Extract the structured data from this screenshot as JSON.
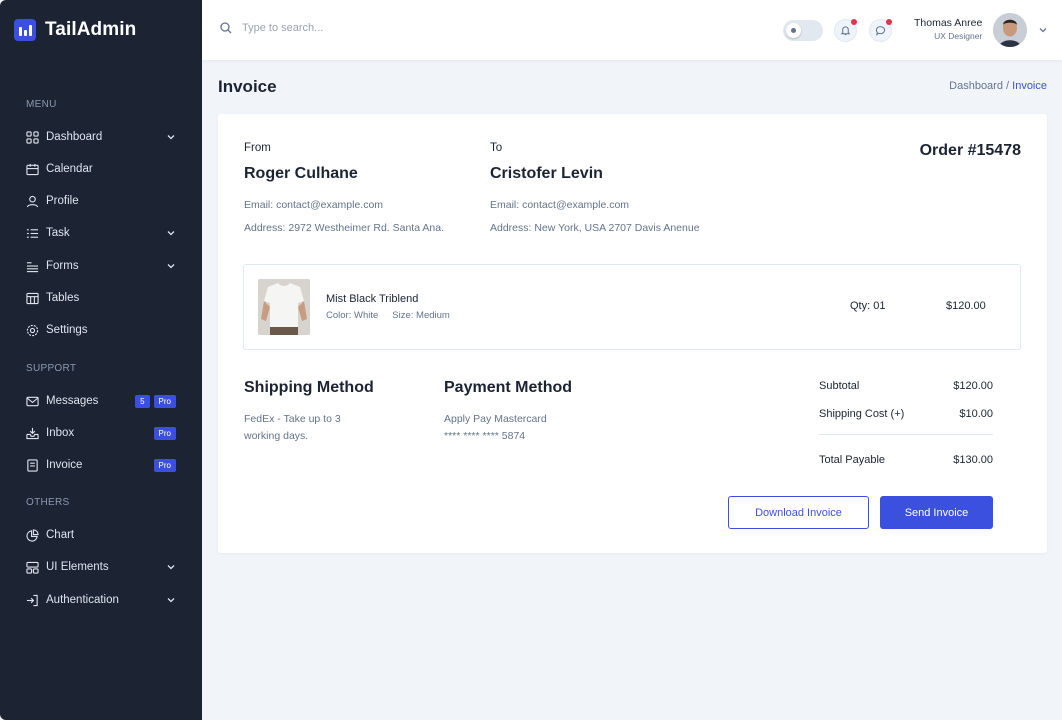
{
  "brand": {
    "name": "TailAdmin",
    "accent": "#3C50E0",
    "sidebar_bg": "#1C2434"
  },
  "sidebar": {
    "groups": [
      {
        "title": "MENU",
        "items": [
          {
            "label": "Dashboard",
            "icon": "grid-icon",
            "chevron": true
          },
          {
            "label": "Calendar",
            "icon": "calendar-icon",
            "chevron": false
          },
          {
            "label": "Profile",
            "icon": "user-icon",
            "chevron": false
          },
          {
            "label": "Task",
            "icon": "list-icon",
            "chevron": true
          },
          {
            "label": "Forms",
            "icon": "form-icon",
            "chevron": true
          },
          {
            "label": "Tables",
            "icon": "table-icon",
            "chevron": false
          },
          {
            "label": "Settings",
            "icon": "gear-icon",
            "chevron": false
          }
        ]
      },
      {
        "title": "SUPPORT",
        "items": [
          {
            "label": "Messages",
            "icon": "mail-icon",
            "count": "5",
            "pro": "Pro"
          },
          {
            "label": "Inbox",
            "icon": "inbox-icon",
            "pro": "Pro"
          },
          {
            "label": "Invoice",
            "icon": "document-icon",
            "pro": "Pro"
          }
        ]
      },
      {
        "title": "OTHERS",
        "items": [
          {
            "label": "Chart",
            "icon": "pie-chart-icon",
            "chevron": false
          },
          {
            "label": "UI Elements",
            "icon": "layout-icon",
            "chevron": true
          },
          {
            "label": "Authentication",
            "icon": "login-icon",
            "chevron": true
          }
        ]
      }
    ]
  },
  "header": {
    "search_placeholder": "Type to search...",
    "user_name": "Thomas Anree",
    "user_role": "UX Designer"
  },
  "page": {
    "title": "Invoice",
    "breadcrumb": {
      "root": "Dashboard /",
      "current": "Invoice"
    }
  },
  "invoice": {
    "from_label": "From",
    "from_name": "Roger Culhane",
    "from_email": "Email: contact@example.com",
    "from_address": "Address: 2972 Westheimer Rd. Santa Ana.",
    "to_label": "To",
    "to_name": "Cristofer Levin",
    "to_email": "Email: contact@example.com",
    "to_address": "Address: New York, USA 2707 Davis Anenue",
    "order": "Order #15478",
    "item": {
      "name": "Mist Black Triblend",
      "color": "Color: White",
      "size": "Size: Medium",
      "qty": "Qty: 01",
      "price": "$120.00"
    },
    "shipping_title": "Shipping Method",
    "shipping_line1": "FedEx - Take up to 3",
    "shipping_line2": "working days.",
    "payment_title": "Payment Method",
    "payment_line1": "Apply Pay Mastercard",
    "payment_line2": "**** **** **** 5874",
    "subtotal_label": "Subtotal",
    "subtotal_value": "$120.00",
    "shipping_cost_label": "Shipping Cost (+)",
    "shipping_cost_value": "$10.00",
    "total_label": "Total Payable",
    "total_value": "$130.00",
    "download_label": "Download Invoice",
    "send_label": "Send Invoice"
  }
}
